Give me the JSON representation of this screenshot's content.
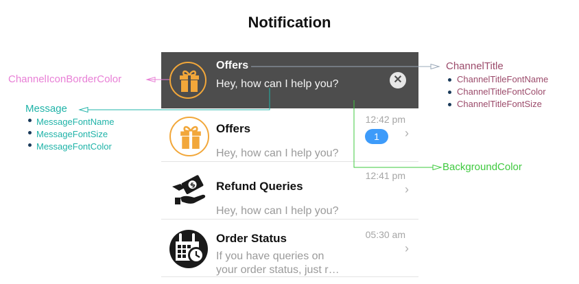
{
  "title": "Notification",
  "banner": {
    "channel_title": "Offers",
    "message": "Hey, how can I help you?",
    "close_glyph": "✕"
  },
  "rows": [
    {
      "title": "Offers",
      "message": "Hey, how can I help you?",
      "time": "12:42 pm",
      "badge": "1",
      "icon": "gift-icon"
    },
    {
      "title": "Refund Queries",
      "message": "Hey, how can I help you?",
      "time": "12:41 pm",
      "icon": "refund-icon"
    },
    {
      "title": "Order Status",
      "message_line1": "If you have queries on",
      "message_line2": "your order status, just r…",
      "time": "05:30 am",
      "icon": "calendar-clock-icon"
    }
  ],
  "chevron": "›",
  "annotations": {
    "channel_icon_border_color": "ChannelIconBorderColor",
    "message": {
      "label": "Message",
      "props": [
        "MessageFontName",
        "MessageFontSize",
        "MessageFontColor"
      ]
    },
    "channel_title": {
      "label": "ChannelTitle",
      "props": [
        "ChannelTitleFontName",
        "ChannelTitleFontColor",
        "ChannelTitleFontSize"
      ]
    },
    "background_color": "BackgroundColor"
  },
  "colors": {
    "banner_bg": "#4d4d4d",
    "icon_border": "#f2a73a",
    "badge": "#3d9bfa",
    "annotation_pink": "#e87fd6",
    "annotation_teal": "#1fb3a8",
    "annotation_maroon": "#9b4a6a",
    "annotation_green": "#3ec93e"
  }
}
